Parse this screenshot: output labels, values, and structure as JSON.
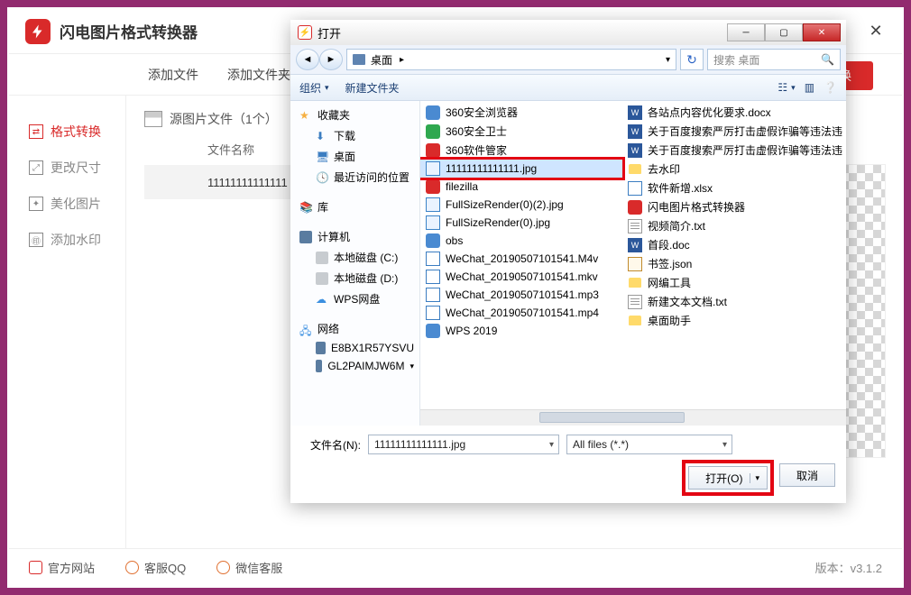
{
  "mainWindow": {
    "title": "闪电图片格式转换器",
    "toolbar": {
      "addFile": "添加文件",
      "addFolder": "添加文件夹",
      "convert": "转换"
    },
    "sidebar": {
      "items": [
        {
          "label": "格式转换",
          "name": "format-convert"
        },
        {
          "label": "更改尺寸",
          "name": "resize"
        },
        {
          "label": "美化图片",
          "name": "beautify"
        },
        {
          "label": "添加水印",
          "name": "watermark"
        }
      ]
    },
    "sourceHeader": "源图片文件（1个）",
    "colName": "文件名称",
    "rowFile": "11111111111111",
    "footer": {
      "site": "官方网站",
      "qq": "客服QQ",
      "wx": "微信客服",
      "ver": "版本：v3.1.2"
    }
  },
  "openDialog": {
    "title": "打开",
    "path": "桌面",
    "searchPlaceholder": "搜索 桌面",
    "organize": "组织",
    "newFolder": "新建文件夹",
    "tree": {
      "fav": "收藏夹",
      "downloads": "下载",
      "desktop": "桌面",
      "recent": "最近访问的位置",
      "lib": "库",
      "computer": "计算机",
      "driveC": "本地磁盘 (C:)",
      "driveD": "本地磁盘 (D:)",
      "wps": "WPS网盘",
      "network": "网络",
      "n1": "E8BX1R57YSVU",
      "n2": "GL2PAIMJW6M"
    },
    "filesLeft": [
      {
        "name": "360安全浏览器",
        "type": "app"
      },
      {
        "name": "360安全卫士",
        "type": "app-g"
      },
      {
        "name": "360软件管家",
        "type": "app-r"
      },
      {
        "name": "11111111111111.jpg",
        "type": "img",
        "selected": true
      },
      {
        "name": "filezilla",
        "type": "app-r"
      },
      {
        "name": "FullSizeRender(0)(2).jpg",
        "type": "img"
      },
      {
        "name": "FullSizeRender(0).jpg",
        "type": "img"
      },
      {
        "name": "obs",
        "type": "app"
      },
      {
        "name": "WeChat_20190507101541.M4v",
        "type": "doc"
      },
      {
        "name": "WeChat_20190507101541.mkv",
        "type": "doc"
      },
      {
        "name": "WeChat_20190507101541.mp3",
        "type": "doc"
      },
      {
        "name": "WeChat_20190507101541.mp4",
        "type": "doc"
      },
      {
        "name": "WPS 2019",
        "type": "app"
      }
    ],
    "filesRight": [
      {
        "name": "各站点内容优化要求.docx",
        "type": "word"
      },
      {
        "name": "关于百度搜索严厉打击虚假诈骗等违法违",
        "type": "word"
      },
      {
        "name": "关于百度搜索严厉打击虚假诈骗等违法违",
        "type": "word"
      },
      {
        "name": "去水印",
        "type": "folder"
      },
      {
        "name": "软件新增.xlsx",
        "type": "doc"
      },
      {
        "name": "闪电图片格式转换器",
        "type": "app-r"
      },
      {
        "name": "视频简介.txt",
        "type": "txt"
      },
      {
        "name": "首段.doc",
        "type": "word"
      },
      {
        "name": "书签.json",
        "type": "json"
      },
      {
        "name": "网编工具",
        "type": "folder"
      },
      {
        "name": "新建文本文档.txt",
        "type": "txt"
      },
      {
        "name": "桌面助手",
        "type": "folder"
      }
    ],
    "fnLabel": "文件名(N):",
    "fnValue": "11111111111111.jpg",
    "filter": "All files (*.*)",
    "openBtn": "打开(O)",
    "cancelBtn": "取消"
  }
}
